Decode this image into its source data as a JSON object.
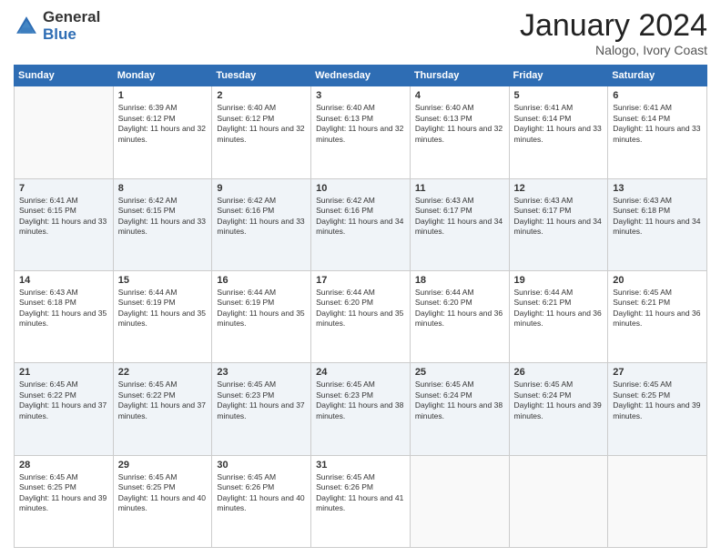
{
  "logo": {
    "general": "General",
    "blue": "Blue"
  },
  "header": {
    "month": "January 2024",
    "location": "Nalogo, Ivory Coast"
  },
  "weekdays": [
    "Sunday",
    "Monday",
    "Tuesday",
    "Wednesday",
    "Thursday",
    "Friday",
    "Saturday"
  ],
  "weeks": [
    [
      {
        "day": "",
        "sunrise": "",
        "sunset": "",
        "daylight": ""
      },
      {
        "day": "1",
        "sunrise": "Sunrise: 6:39 AM",
        "sunset": "Sunset: 6:12 PM",
        "daylight": "Daylight: 11 hours and 32 minutes."
      },
      {
        "day": "2",
        "sunrise": "Sunrise: 6:40 AM",
        "sunset": "Sunset: 6:12 PM",
        "daylight": "Daylight: 11 hours and 32 minutes."
      },
      {
        "day": "3",
        "sunrise": "Sunrise: 6:40 AM",
        "sunset": "Sunset: 6:13 PM",
        "daylight": "Daylight: 11 hours and 32 minutes."
      },
      {
        "day": "4",
        "sunrise": "Sunrise: 6:40 AM",
        "sunset": "Sunset: 6:13 PM",
        "daylight": "Daylight: 11 hours and 32 minutes."
      },
      {
        "day": "5",
        "sunrise": "Sunrise: 6:41 AM",
        "sunset": "Sunset: 6:14 PM",
        "daylight": "Daylight: 11 hours and 33 minutes."
      },
      {
        "day": "6",
        "sunrise": "Sunrise: 6:41 AM",
        "sunset": "Sunset: 6:14 PM",
        "daylight": "Daylight: 11 hours and 33 minutes."
      }
    ],
    [
      {
        "day": "7",
        "sunrise": "Sunrise: 6:41 AM",
        "sunset": "Sunset: 6:15 PM",
        "daylight": "Daylight: 11 hours and 33 minutes."
      },
      {
        "day": "8",
        "sunrise": "Sunrise: 6:42 AM",
        "sunset": "Sunset: 6:15 PM",
        "daylight": "Daylight: 11 hours and 33 minutes."
      },
      {
        "day": "9",
        "sunrise": "Sunrise: 6:42 AM",
        "sunset": "Sunset: 6:16 PM",
        "daylight": "Daylight: 11 hours and 33 minutes."
      },
      {
        "day": "10",
        "sunrise": "Sunrise: 6:42 AM",
        "sunset": "Sunset: 6:16 PM",
        "daylight": "Daylight: 11 hours and 34 minutes."
      },
      {
        "day": "11",
        "sunrise": "Sunrise: 6:43 AM",
        "sunset": "Sunset: 6:17 PM",
        "daylight": "Daylight: 11 hours and 34 minutes."
      },
      {
        "day": "12",
        "sunrise": "Sunrise: 6:43 AM",
        "sunset": "Sunset: 6:17 PM",
        "daylight": "Daylight: 11 hours and 34 minutes."
      },
      {
        "day": "13",
        "sunrise": "Sunrise: 6:43 AM",
        "sunset": "Sunset: 6:18 PM",
        "daylight": "Daylight: 11 hours and 34 minutes."
      }
    ],
    [
      {
        "day": "14",
        "sunrise": "Sunrise: 6:43 AM",
        "sunset": "Sunset: 6:18 PM",
        "daylight": "Daylight: 11 hours and 35 minutes."
      },
      {
        "day": "15",
        "sunrise": "Sunrise: 6:44 AM",
        "sunset": "Sunset: 6:19 PM",
        "daylight": "Daylight: 11 hours and 35 minutes."
      },
      {
        "day": "16",
        "sunrise": "Sunrise: 6:44 AM",
        "sunset": "Sunset: 6:19 PM",
        "daylight": "Daylight: 11 hours and 35 minutes."
      },
      {
        "day": "17",
        "sunrise": "Sunrise: 6:44 AM",
        "sunset": "Sunset: 6:20 PM",
        "daylight": "Daylight: 11 hours and 35 minutes."
      },
      {
        "day": "18",
        "sunrise": "Sunrise: 6:44 AM",
        "sunset": "Sunset: 6:20 PM",
        "daylight": "Daylight: 11 hours and 36 minutes."
      },
      {
        "day": "19",
        "sunrise": "Sunrise: 6:44 AM",
        "sunset": "Sunset: 6:21 PM",
        "daylight": "Daylight: 11 hours and 36 minutes."
      },
      {
        "day": "20",
        "sunrise": "Sunrise: 6:45 AM",
        "sunset": "Sunset: 6:21 PM",
        "daylight": "Daylight: 11 hours and 36 minutes."
      }
    ],
    [
      {
        "day": "21",
        "sunrise": "Sunrise: 6:45 AM",
        "sunset": "Sunset: 6:22 PM",
        "daylight": "Daylight: 11 hours and 37 minutes."
      },
      {
        "day": "22",
        "sunrise": "Sunrise: 6:45 AM",
        "sunset": "Sunset: 6:22 PM",
        "daylight": "Daylight: 11 hours and 37 minutes."
      },
      {
        "day": "23",
        "sunrise": "Sunrise: 6:45 AM",
        "sunset": "Sunset: 6:23 PM",
        "daylight": "Daylight: 11 hours and 37 minutes."
      },
      {
        "day": "24",
        "sunrise": "Sunrise: 6:45 AM",
        "sunset": "Sunset: 6:23 PM",
        "daylight": "Daylight: 11 hours and 38 minutes."
      },
      {
        "day": "25",
        "sunrise": "Sunrise: 6:45 AM",
        "sunset": "Sunset: 6:24 PM",
        "daylight": "Daylight: 11 hours and 38 minutes."
      },
      {
        "day": "26",
        "sunrise": "Sunrise: 6:45 AM",
        "sunset": "Sunset: 6:24 PM",
        "daylight": "Daylight: 11 hours and 39 minutes."
      },
      {
        "day": "27",
        "sunrise": "Sunrise: 6:45 AM",
        "sunset": "Sunset: 6:25 PM",
        "daylight": "Daylight: 11 hours and 39 minutes."
      }
    ],
    [
      {
        "day": "28",
        "sunrise": "Sunrise: 6:45 AM",
        "sunset": "Sunset: 6:25 PM",
        "daylight": "Daylight: 11 hours and 39 minutes."
      },
      {
        "day": "29",
        "sunrise": "Sunrise: 6:45 AM",
        "sunset": "Sunset: 6:25 PM",
        "daylight": "Daylight: 11 hours and 40 minutes."
      },
      {
        "day": "30",
        "sunrise": "Sunrise: 6:45 AM",
        "sunset": "Sunset: 6:26 PM",
        "daylight": "Daylight: 11 hours and 40 minutes."
      },
      {
        "day": "31",
        "sunrise": "Sunrise: 6:45 AM",
        "sunset": "Sunset: 6:26 PM",
        "daylight": "Daylight: 11 hours and 41 minutes."
      },
      {
        "day": "",
        "sunrise": "",
        "sunset": "",
        "daylight": ""
      },
      {
        "day": "",
        "sunrise": "",
        "sunset": "",
        "daylight": ""
      },
      {
        "day": "",
        "sunrise": "",
        "sunset": "",
        "daylight": ""
      }
    ]
  ]
}
